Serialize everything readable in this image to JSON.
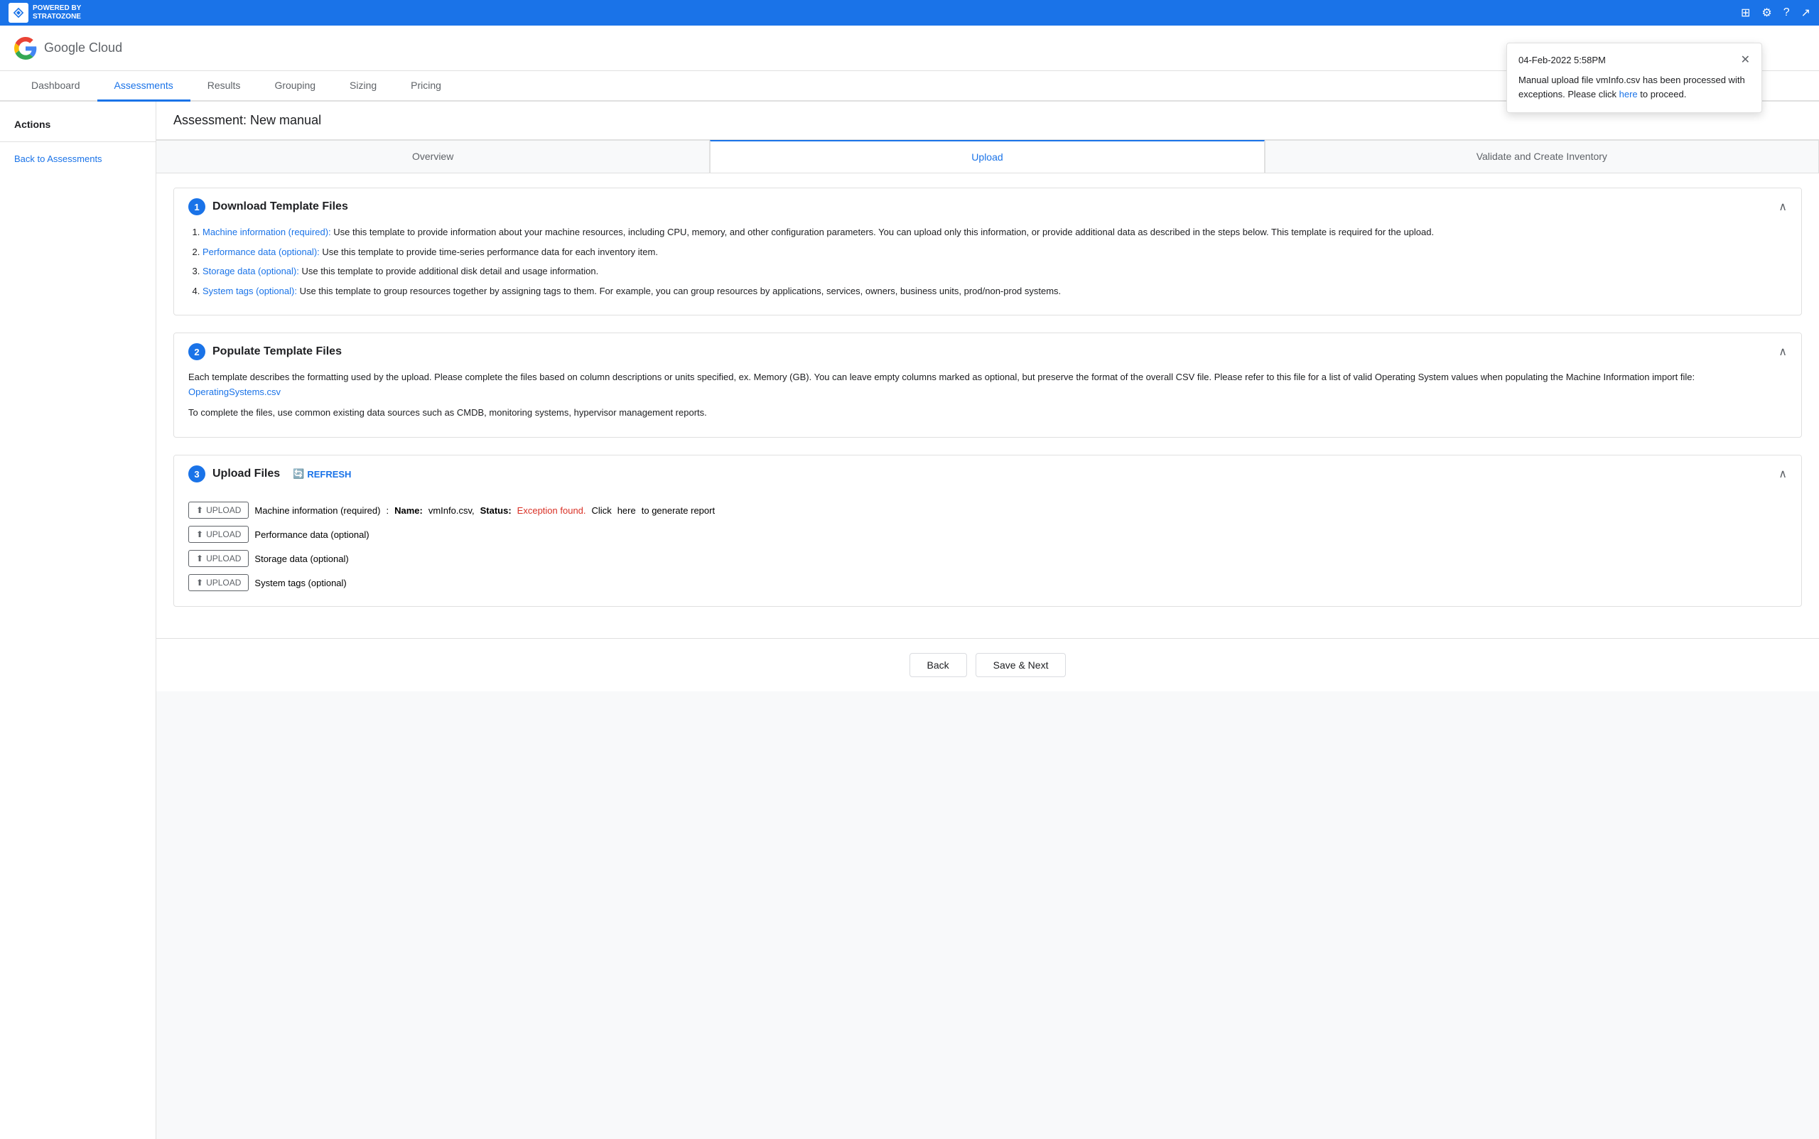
{
  "topbar": {
    "brand": "POWERED BY\nSTRATOZONE",
    "icons": [
      "grid-icon",
      "settings-icon",
      "help-icon",
      "share-icon"
    ]
  },
  "header": {
    "app_name": "Google Cloud"
  },
  "nav_tabs": [
    {
      "id": "dashboard",
      "label": "Dashboard",
      "active": false
    },
    {
      "id": "assessments",
      "label": "Assessments",
      "active": true
    },
    {
      "id": "results",
      "label": "Results",
      "active": false
    },
    {
      "id": "grouping",
      "label": "Grouping",
      "active": false
    },
    {
      "id": "sizing",
      "label": "Sizing",
      "active": false
    },
    {
      "id": "pricing",
      "label": "Pricing",
      "active": false
    }
  ],
  "sidebar": {
    "section_title": "Actions",
    "links": [
      {
        "id": "back-to-assessments",
        "label": "Back to Assessments"
      }
    ]
  },
  "assessment": {
    "title": "Assessment: New manual",
    "step_tabs": [
      {
        "id": "overview",
        "label": "Overview",
        "active": false
      },
      {
        "id": "upload",
        "label": "Upload",
        "active": true
      },
      {
        "id": "validate",
        "label": "Validate and Create Inventory",
        "active": false
      }
    ],
    "steps": [
      {
        "number": "1",
        "title": "Download Template Files",
        "items": [
          {
            "link_text": "Machine information (required):",
            "description": " Use this template to provide information about your machine resources, including CPU, memory, and other configuration parameters. You can upload only this information, or provide additional data as described in the steps below. This template is required for the upload."
          },
          {
            "link_text": "Performance data (optional):",
            "description": " Use this template to provide time-series performance data for each inventory item."
          },
          {
            "link_text": "Storage data (optional):",
            "description": " Use this template to provide additional disk detail and usage information."
          },
          {
            "link_text": "System tags (optional):",
            "description": " Use this template to group resources together by assigning tags to them. For example, you can group resources by applications, services, owners, business units, prod/non-prod systems."
          }
        ]
      },
      {
        "number": "2",
        "title": "Populate Template Files",
        "body_text_1": "Each template describes the formatting used by the upload. Please complete the files based on column descriptions or units specified, ex. Memory (GB). You can leave empty columns marked as optional, but preserve the format of the overall CSV file. Please refer to this file for a list of valid Operating System values when populating the Machine Information import file:",
        "operating_systems_link": "OperatingSystems.csv",
        "body_text_2": "To complete the files, use common existing data sources such as CMDB, monitoring systems, hypervisor management reports."
      },
      {
        "number": "3",
        "title": "Upload Files",
        "refresh_label": "REFRESH",
        "upload_rows": [
          {
            "btn_label": "UPLOAD",
            "description": "Machine information (required)",
            "name_label": "Name:",
            "name_value": "vmInfo.csv,",
            "status_label": "Status:",
            "status_text": "Exception found.",
            "status_type": "exception",
            "after_text": "Click",
            "here_link": "here",
            "after_link": "to generate report"
          },
          {
            "btn_label": "UPLOAD",
            "description": "Performance data (optional)",
            "name_label": "",
            "name_value": "",
            "status_label": "",
            "status_text": "",
            "status_type": "normal",
            "after_text": "",
            "here_link": "",
            "after_link": ""
          },
          {
            "btn_label": "UPLOAD",
            "description": "Storage data (optional)",
            "name_label": "",
            "name_value": "",
            "status_label": "",
            "status_text": "",
            "status_type": "normal",
            "after_text": "",
            "here_link": "",
            "after_link": ""
          },
          {
            "btn_label": "UPLOAD",
            "description": "System tags (optional)",
            "name_label": "",
            "name_value": "",
            "status_label": "",
            "status_text": "",
            "status_type": "normal",
            "after_text": "",
            "here_link": "",
            "after_link": ""
          }
        ]
      }
    ],
    "footer": {
      "back_label": "Back",
      "save_next_label": "Save & Next"
    }
  },
  "notification": {
    "date": "04-Feb-2022 5:58PM",
    "message_before": "Manual upload file vmInfo.csv has been processed with exceptions. Please click",
    "here_link": "here",
    "message_after": "to proceed.",
    "close_icon": "close-icon"
  }
}
